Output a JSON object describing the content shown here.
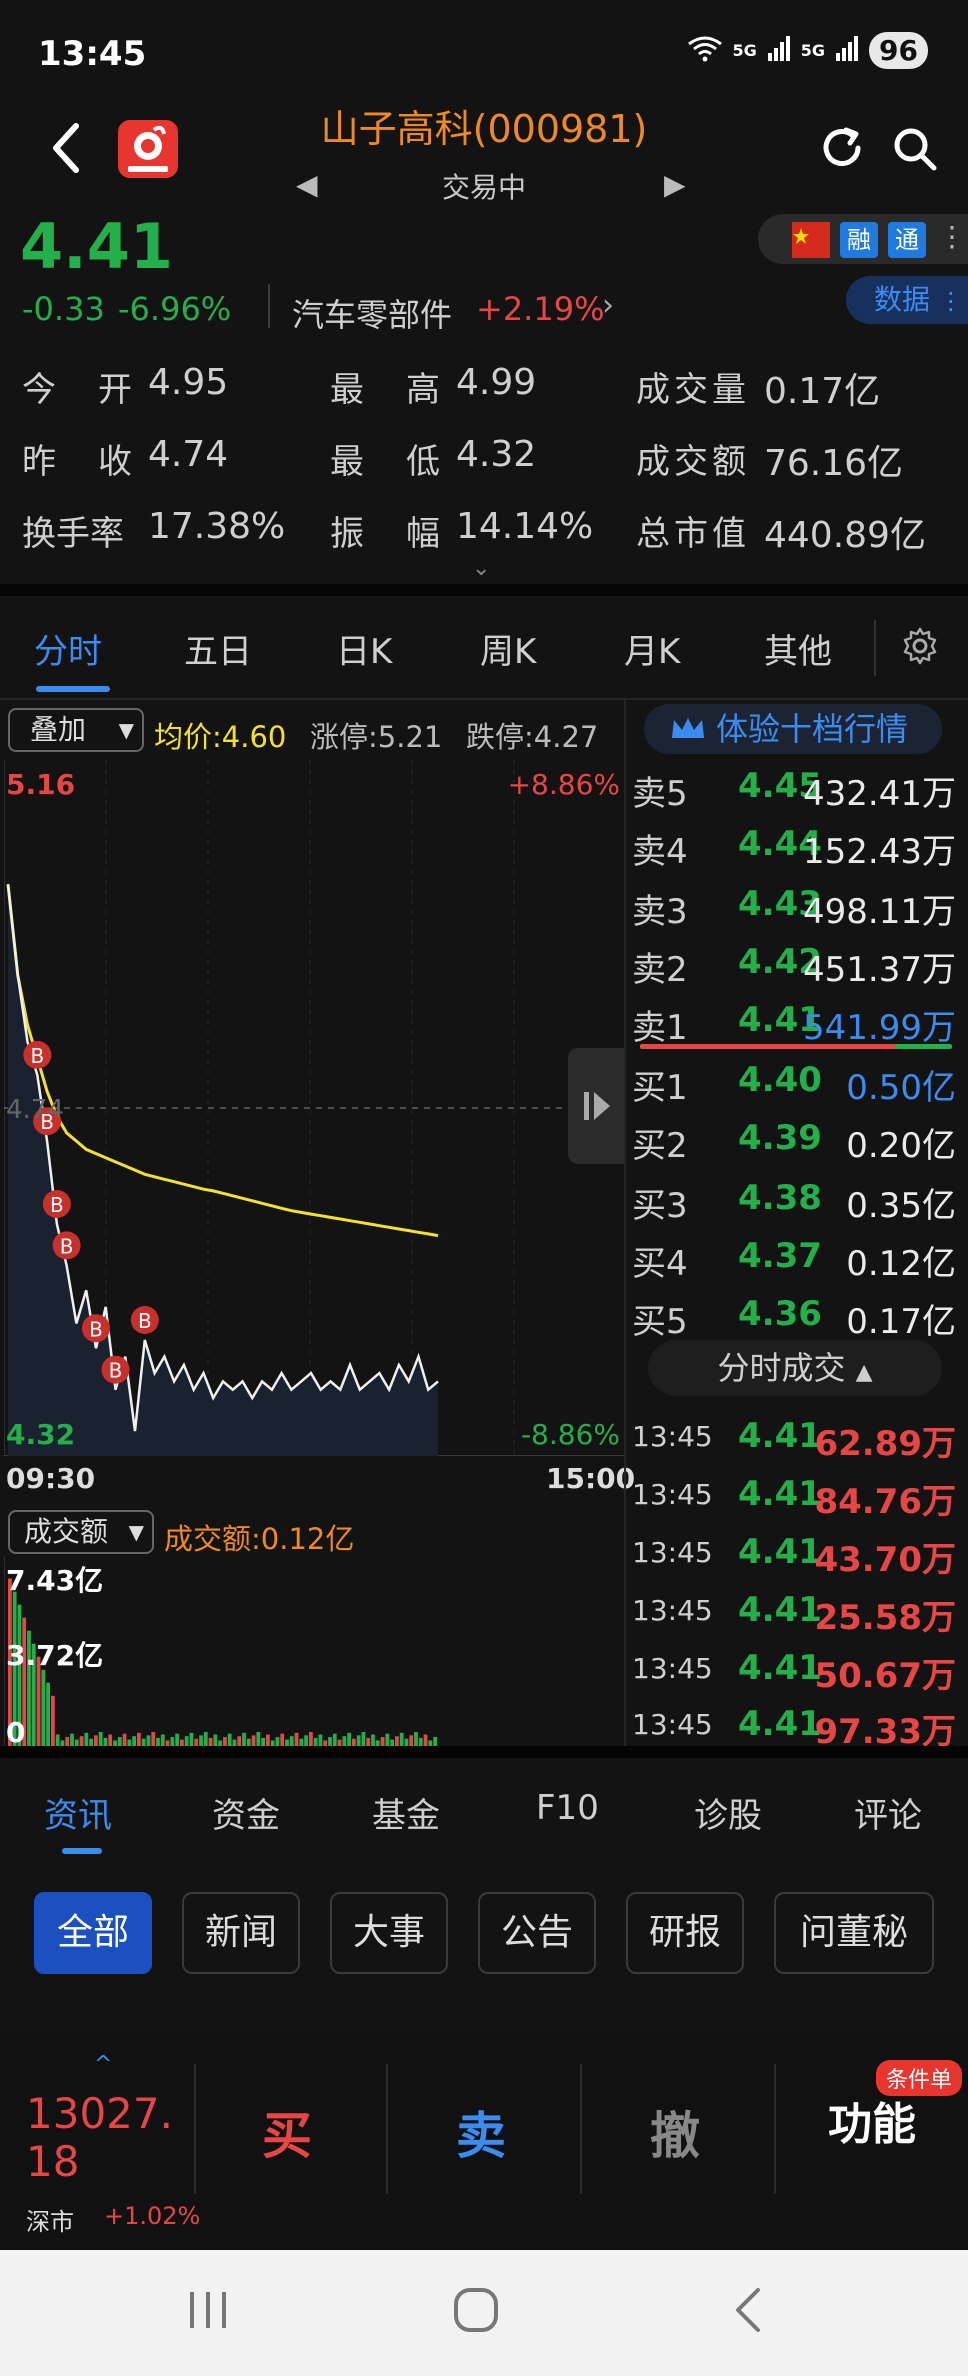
{
  "status_bar": {
    "time": "13:45",
    "network1": "5G",
    "network2": "5G",
    "battery": "96"
  },
  "header": {
    "title": "山子高科(000981)",
    "trade_status": "交易中"
  },
  "quote": {
    "price": "4.41",
    "change": "-0.33",
    "change_pct": "-6.96%",
    "sector": "汽车零部件",
    "sector_change": "+2.19%",
    "badges": [
      "融",
      "通"
    ],
    "data_button": "数据"
  },
  "stats": [
    {
      "label": "今　开",
      "value": "4.95"
    },
    {
      "label": "最　高",
      "value": "4.99"
    },
    {
      "label": "成交量",
      "value": "0.17亿"
    },
    {
      "label": "昨　收",
      "value": "4.74"
    },
    {
      "label": "最　低",
      "value": "4.32"
    },
    {
      "label": "成交额",
      "value": "76.16亿"
    },
    {
      "label": "换手率",
      "value": "17.38%"
    },
    {
      "label": "振　幅",
      "value": "14.14%"
    },
    {
      "label": "总市值",
      "value": "440.89亿"
    }
  ],
  "chart_tabs": [
    "分时",
    "五日",
    "日K",
    "周K",
    "月K",
    "其他"
  ],
  "chart_header": {
    "overlay": "叠加",
    "avg_price": "均价:4.60",
    "limit_up": "涨停:5.21",
    "limit_down": "跌停:4.27"
  },
  "chart_data": {
    "type": "line",
    "y_max_label": "5.16",
    "y_min_label": "4.32",
    "pct_max_label": "+8.86%",
    "pct_min_label": "-8.86%",
    "prev_close_label": "4.74",
    "x_start": "09:30",
    "x_end": "15:00",
    "ylim": [
      4.32,
      5.16
    ],
    "series": [
      {
        "values": [
          5.01,
          4.9,
          4.82,
          4.78,
          4.7,
          4.6,
          4.55,
          4.48,
          4.52,
          4.45,
          4.5,
          4.4,
          4.44,
          4.35,
          4.46,
          4.42,
          4.44,
          4.41,
          4.43,
          4.4,
          4.42,
          4.39,
          4.41,
          4.4,
          4.41,
          4.39,
          4.41,
          4.4,
          4.42,
          4.4,
          4.41,
          4.42,
          4.4,
          4.41,
          4.4,
          4.43,
          4.4,
          4.41,
          4.42,
          4.4,
          4.43,
          4.41,
          4.44,
          4.4,
          4.41
        ]
      },
      {
        "values": [
          5.01,
          4.9,
          4.84,
          4.8,
          4.76,
          4.73,
          4.71,
          4.7,
          4.69,
          4.685,
          4.68,
          4.675,
          4.67,
          4.665,
          4.66,
          4.657,
          4.654,
          4.651,
          4.648,
          4.645,
          4.642,
          4.64,
          4.637,
          4.634,
          4.631,
          4.628,
          4.625,
          4.622,
          4.619,
          4.616,
          4.614,
          4.612,
          4.61,
          4.608,
          4.606,
          4.604,
          4.602,
          4.6,
          4.598,
          4.596,
          4.594,
          4.592,
          4.59,
          4.588,
          4.586
        ]
      }
    ],
    "markers": [
      "B",
      "B",
      "B",
      "B",
      "B",
      "B",
      "B"
    ],
    "volume": {
      "label": "成交额:0.12亿",
      "selector": "成交额",
      "ticks": [
        "7.43亿",
        "3.72亿",
        "0"
      ],
      "ylim": [
        0,
        7.43
      ]
    }
  },
  "order_book": {
    "header": "体验十档行情",
    "asks": [
      {
        "label": "卖5",
        "price": "4.45",
        "volume": "432.41万"
      },
      {
        "label": "卖4",
        "price": "4.44",
        "volume": "152.43万"
      },
      {
        "label": "卖3",
        "price": "4.43",
        "volume": "498.11万"
      },
      {
        "label": "卖2",
        "price": "4.42",
        "volume": "451.37万"
      },
      {
        "label": "卖1",
        "price": "4.41",
        "volume": "541.99万"
      }
    ],
    "bids": [
      {
        "label": "买1",
        "price": "4.40",
        "volume": "0.50亿"
      },
      {
        "label": "买2",
        "price": "4.39",
        "volume": "0.20亿"
      },
      {
        "label": "买3",
        "price": "4.38",
        "volume": "0.35亿"
      },
      {
        "label": "买4",
        "price": "4.37",
        "volume": "0.12亿"
      },
      {
        "label": "买5",
        "price": "4.36",
        "volume": "0.17亿"
      }
    ]
  },
  "ticks": {
    "header": "分时成交",
    "rows": [
      {
        "time": "13:45",
        "price": "4.41",
        "volume": "62.89万"
      },
      {
        "time": "13:45",
        "price": "4.41",
        "volume": "84.76万"
      },
      {
        "time": "13:45",
        "price": "4.41",
        "volume": "43.70万"
      },
      {
        "time": "13:45",
        "price": "4.41",
        "volume": "25.58万"
      },
      {
        "time": "13:45",
        "price": "4.41",
        "volume": "50.67万"
      },
      {
        "time": "13:45",
        "price": "4.41",
        "volume": "97.33万"
      }
    ]
  },
  "info_tabs": [
    "资讯",
    "资金",
    "基金",
    "F10",
    "诊股",
    "评论"
  ],
  "news_chips": [
    "全部",
    "新闻",
    "大事",
    "公告",
    "研报",
    "问董秘"
  ],
  "bottom_bar": {
    "index_value": "13027.18",
    "index_name": "深市",
    "index_change": "+1.02%",
    "buy": "买",
    "sell": "卖",
    "cancel": "撤",
    "function": "功能",
    "cond_badge": "条件单"
  },
  "colors": {
    "up": "#e84545",
    "down": "#22b04b",
    "accent": "#3b8cf0",
    "avg_line": "#f4e227",
    "title": "#f08a1c"
  }
}
